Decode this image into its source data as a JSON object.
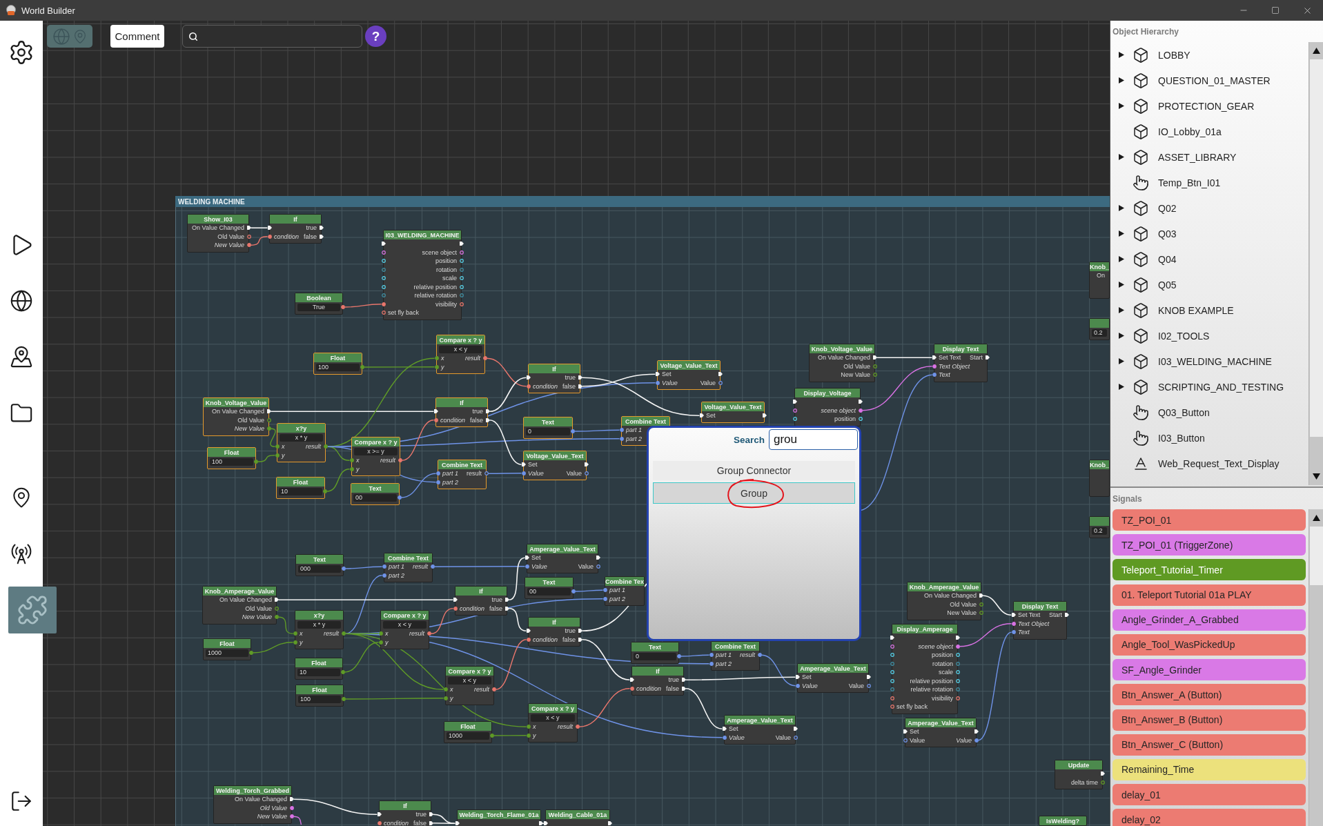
{
  "window": {
    "title": "World Builder"
  },
  "sidebar": {
    "items": [
      {
        "selected": false
      },
      {
        "selected": false
      },
      {
        "selected": false
      },
      {
        "selected": false
      },
      {
        "selected": false
      },
      {
        "selected": false
      },
      {
        "selected": false
      },
      {
        "selected": true
      },
      {
        "selected": false
      }
    ]
  },
  "toolbar": {
    "map_toggle": {
      "disabled": true
    },
    "comment_button": "Comment",
    "help_button": "?"
  },
  "graph": {
    "group": {
      "title": "WELDING MACHINE"
    },
    "nodes": [
      {
        "title": "Show_I03",
        "selected": false,
        "rows": [
          {
            "out": {
              "kind": "exec",
              "label": "On Value Changed"
            }
          },
          {
            "out": {
              "kind": "bool",
              "label": "Old Value",
              "connected": false
            }
          },
          {
            "out": {
              "kind": "bool",
              "label": "New Value",
              "connected": true
            }
          }
        ]
      },
      {
        "title": "If",
        "selected": false,
        "rows": [
          {
            "in": {
              "kind": "exec"
            },
            "out": {
              "kind": "exec",
              "label": "true"
            }
          },
          {
            "in": {
              "kind": "bool",
              "label": "condition",
              "connected": true
            },
            "out": {
              "kind": "exec",
              "label": "false"
            }
          }
        ]
      },
      {
        "title": "Boolean",
        "selected": false,
        "value": "True",
        "value_port": {
          "kind": "bool",
          "connected": true
        }
      },
      {
        "title": "I03_WELDING_MACHINE",
        "selected": false,
        "rows": [
          {
            "in": {
              "kind": "exec"
            },
            "out": {
              "kind": "exec"
            }
          },
          {
            "in": {
              "kind": "object",
              "connected": false
            },
            "out": {
              "kind": "object",
              "label": "scene object",
              "connected": false
            }
          },
          {
            "in": {
              "kind": "vector",
              "connected": false
            },
            "out": {
              "kind": "vector",
              "label": "position",
              "connected": false
            }
          },
          {
            "in": {
              "kind": "rotation",
              "connected": false
            },
            "out": {
              "kind": "rotation",
              "label": "rotation",
              "connected": false
            }
          },
          {
            "in": {
              "kind": "vector",
              "connected": false
            },
            "out": {
              "kind": "vector",
              "label": "scale",
              "connected": false
            }
          },
          {
            "in": {
              "kind": "vector",
              "connected": false
            },
            "out": {
              "kind": "vector",
              "label": "relative position",
              "connected": false
            }
          },
          {
            "in": {
              "kind": "rotation",
              "connected": false
            },
            "out": {
              "kind": "rotation",
              "label": "relative rotation",
              "connected": false
            }
          },
          {
            "in": {
              "kind": "bool",
              "connected": true
            },
            "out": {
              "kind": "bool",
              "label": "visibility",
              "connected": false
            }
          },
          {
            "in": {
              "kind": "bool",
              "label": "set fly back",
              "connected": false
            }
          }
        ]
      },
      {
        "title": "Knob_",
        "selected": false,
        "rows": [
          {
            "out": {
              "label": "On"
            }
          }
        ]
      },
      {
        "selected": false,
        "value": "0.2"
      },
      {
        "title": "Float",
        "selected": true,
        "value": "100",
        "value_port": {
          "kind": "number",
          "connected": true
        }
      },
      {
        "title": "Compare x ? y",
        "selected": true,
        "mode": "x < y",
        "rows": [
          {
            "in": {
              "kind": "number",
              "label": "x",
              "connected": true
            },
            "out": {
              "kind": "bool",
              "label": "result",
              "connected": true
            }
          },
          {
            "in": {
              "kind": "number",
              "label": "y",
              "connected": true
            }
          }
        ]
      },
      {
        "title": "If",
        "selected": true,
        "rows": [
          {
            "in": {
              "kind": "exec"
            },
            "out": {
              "kind": "exec",
              "label": "true"
            }
          },
          {
            "in": {
              "kind": "bool",
              "label": "condition",
              "connected": true
            },
            "out": {
              "kind": "exec",
              "label": "false"
            }
          }
        ]
      },
      {
        "title": "Voltage_Value_Text",
        "selected": true,
        "rows": [
          {
            "in": {
              "kind": "exec",
              "label": "Set"
            },
            "out": {
              "kind": "exec"
            }
          },
          {
            "in": {
              "kind": "text",
              "label": "Value",
              "connected": true
            },
            "out": {
              "kind": "text",
              "label": "Value",
              "connected": false
            }
          }
        ]
      },
      {
        "title": "Knob_Voltage_Value",
        "selected": false,
        "rows": [
          {
            "out": {
              "kind": "exec",
              "label": "On Value Changed"
            }
          },
          {
            "out": {
              "kind": "number",
              "label": "Old Value",
              "connected": false
            }
          },
          {
            "out": {
              "kind": "number",
              "label": "New Value",
              "connected": false
            }
          }
        ]
      },
      {
        "title": "Display Text",
        "selected": false,
        "rows": [
          {
            "in": {
              "kind": "exec",
              "label": "Set Text"
            },
            "out": {
              "kind": "exec",
              "label": "Start"
            }
          },
          {
            "in": {
              "kind": "object",
              "label": "Text Object",
              "connected": true
            }
          },
          {
            "in": {
              "kind": "text",
              "label": "Text",
              "connected": true
            }
          }
        ]
      },
      {
        "title": "Knob_Voltage_Value",
        "selected": true,
        "rows": [
          {
            "out": {
              "kind": "exec",
              "label": "On Value Changed"
            }
          },
          {
            "out": {
              "kind": "number",
              "label": "Old Value",
              "connected": false
            }
          },
          {
            "out": {
              "kind": "number",
              "label": "New Value",
              "connected": true
            }
          }
        ]
      },
      {
        "title": "If",
        "selected": true,
        "rows": [
          {
            "in": {
              "kind": "exec"
            },
            "out": {
              "kind": "exec",
              "label": "true"
            }
          },
          {
            "in": {
              "kind": "bool",
              "label": "condition",
              "connected": true
            },
            "out": {
              "kind": "exec",
              "label": "false"
            }
          }
        ]
      },
      {
        "title": "Voltage_Value_Text",
        "selected": true,
        "rows": [
          {
            "in": {
              "kind": "exec",
              "label": "Set"
            },
            "out": {
              "kind": "exec"
            }
          }
        ]
      },
      {
        "title": "Display_Voltage",
        "selected": false,
        "rows": [
          {
            "in": {
              "kind": "exec"
            },
            "out": {
              "kind": "exec"
            }
          },
          {
            "in": {
              "kind": "object",
              "connected": false
            },
            "out": {
              "kind": "object",
              "label": "scene object",
              "connected": true
            }
          },
          {
            "in": {
              "kind": "vector",
              "connected": false
            },
            "out": {
              "kind": "vector",
              "label": "position",
              "connected": false
            }
          }
        ]
      },
      {
        "title": "Float",
        "selected": true,
        "value": "100",
        "value_port": {
          "kind": "number",
          "connected": true
        }
      },
      {
        "title": "x?y",
        "selected": true,
        "mode": "x * y",
        "rows": [
          {
            "in": {
              "kind": "number",
              "label": "x",
              "connected": true
            },
            "out": {
              "kind": "number",
              "label": "result",
              "connected": true
            }
          },
          {
            "in": {
              "kind": "number",
              "label": "y",
              "connected": true
            }
          }
        ]
      },
      {
        "title": "Text",
        "selected": true,
        "value": "0",
        "value_port": {
          "kind": "text",
          "connected": true
        }
      },
      {
        "title": "Combine Text",
        "selected": true,
        "rows": [
          {
            "in": {
              "kind": "text",
              "label": "part 1",
              "connected": true
            }
          },
          {
            "in": {
              "kind": "text",
              "label": "part 2",
              "connected": true
            }
          }
        ]
      },
      {
        "title": "Compare x ? y",
        "selected": true,
        "mode": "x >= y",
        "rows": [
          {
            "in": {
              "kind": "number",
              "label": "x",
              "connected": true
            },
            "out": {
              "kind": "bool",
              "label": "result",
              "connected": true
            }
          },
          {
            "in": {
              "kind": "number",
              "label": "y",
              "connected": true
            }
          }
        ]
      },
      {
        "title": "Float",
        "selected": true,
        "value": "10",
        "value_port": {
          "kind": "number",
          "connected": true
        }
      },
      {
        "title": "Combine Text",
        "selected": true,
        "rows": [
          {
            "in": {
              "kind": "text",
              "label": "part 1",
              "connected": true
            },
            "out": {
              "kind": "text",
              "label": "result",
              "connected": false
            }
          },
          {
            "in": {
              "kind": "text",
              "label": "part 2",
              "connected": true
            }
          }
        ]
      },
      {
        "title": "Voltage_Value_Text",
        "selected": true,
        "rows": [
          {
            "in": {
              "kind": "exec",
              "label": "Set"
            },
            "out": {
              "kind": "exec"
            }
          },
          {
            "in": {
              "kind": "text",
              "label": "Value",
              "connected": true
            },
            "out": {
              "kind": "text",
              "label": "Value",
              "connected": false
            }
          }
        ]
      },
      {
        "title": "Text",
        "selected": true,
        "value": "00",
        "value_port": {
          "kind": "text",
          "connected": true
        }
      },
      {
        "title": "Knob_",
        "selected": false
      },
      {
        "selected": false,
        "value": "0.2"
      },
      {
        "title": "Text",
        "selected": false,
        "value": "000",
        "value_port": {
          "kind": "text",
          "connected": true
        }
      },
      {
        "title": "Combine Text",
        "selected": false,
        "rows": [
          {
            "in": {
              "kind": "text",
              "label": "part 1",
              "connected": true
            },
            "out": {
              "kind": "text",
              "label": "result",
              "connected": true
            }
          },
          {
            "in": {
              "kind": "text",
              "label": "part 2",
              "connected": true
            }
          }
        ]
      },
      {
        "title": "Amperage_Value_Text",
        "selected": false,
        "rows": [
          {
            "in": {
              "kind": "exec",
              "label": "Set"
            },
            "out": {
              "kind": "exec"
            }
          },
          {
            "in": {
              "kind": "text",
              "label": "Value",
              "connected": true
            },
            "out": {
              "kind": "text",
              "label": "Value",
              "connected": false
            }
          }
        ]
      },
      {
        "title": "Knob_Amperage_Value",
        "selected": false,
        "rows": [
          {
            "out": {
              "kind": "exec",
              "label": "On Value Changed"
            }
          },
          {
            "out": {
              "kind": "number",
              "label": "Old Value",
              "connected": false
            }
          },
          {
            "out": {
              "kind": "number",
              "label": "New Value",
              "connected": true
            }
          }
        ]
      },
      {
        "title": "If",
        "selected": false,
        "rows": [
          {
            "in": {
              "kind": "exec"
            },
            "out": {
              "kind": "exec",
              "label": "true"
            }
          },
          {
            "in": {
              "kind": "bool",
              "label": "condition",
              "connected": true
            },
            "out": {
              "kind": "exec",
              "label": "false"
            }
          }
        ]
      },
      {
        "title": "Text",
        "selected": false,
        "value": "00",
        "value_port": {
          "kind": "text",
          "connected": true
        }
      },
      {
        "title": "Combine Tex",
        "selected": false,
        "rows": [
          {
            "in": {
              "kind": "text",
              "label": "part 1",
              "connected": true
            }
          },
          {
            "in": {
              "kind": "text",
              "label": "part 2",
              "connected": true
            }
          }
        ]
      },
      {
        "title": "Knob_Amperage_Value",
        "selected": false,
        "rows": [
          {
            "out": {
              "kind": "exec",
              "label": "On Value Changed"
            }
          },
          {
            "out": {
              "kind": "number",
              "label": "Old Value",
              "connected": false
            }
          },
          {
            "out": {
              "kind": "number",
              "label": "New Value",
              "connected": false
            }
          }
        ]
      },
      {
        "title": "Float",
        "selected": false,
        "value": "1000",
        "value_port": {
          "kind": "number",
          "connected": true
        }
      },
      {
        "title": "x?y",
        "selected": false,
        "mode": "x * y",
        "rows": [
          {
            "in": {
              "kind": "number",
              "label": "x",
              "connected": true
            },
            "out": {
              "kind": "number",
              "label": "result",
              "connected": true
            }
          },
          {
            "in": {
              "kind": "number",
              "label": "y",
              "connected": true
            }
          }
        ]
      },
      {
        "title": "Compare x ? y",
        "selected": false,
        "mode": "x < y",
        "rows": [
          {
            "in": {
              "kind": "number",
              "label": "x",
              "connected": true
            },
            "out": {
              "kind": "bool",
              "label": "result",
              "connected": true
            }
          },
          {
            "in": {
              "kind": "number",
              "label": "y",
              "connected": true
            }
          }
        ]
      },
      {
        "title": "If",
        "selected": false,
        "rows": [
          {
            "in": {
              "kind": "exec"
            },
            "out": {
              "kind": "exec",
              "label": "true"
            }
          },
          {
            "in": {
              "kind": "bool",
              "label": "condition",
              "connected": true
            },
            "out": {
              "kind": "exec",
              "label": "false"
            }
          }
        ]
      },
      {
        "title": "Display Text",
        "selected": false,
        "rows": [
          {
            "in": {
              "kind": "exec",
              "label": "Set Text"
            },
            "out": {
              "kind": "exec",
              "label": "Start"
            }
          },
          {
            "in": {
              "kind": "object",
              "label": "Text Object",
              "connected": true
            }
          },
          {
            "in": {
              "kind": "text",
              "label": "Text",
              "connected": true
            }
          }
        ]
      },
      {
        "title": "Float",
        "selected": false,
        "value": "10",
        "value_port": {
          "kind": "number",
          "connected": true
        }
      },
      {
        "title": "Text",
        "selected": false,
        "value": "0",
        "value_port": {
          "kind": "text",
          "connected": true
        }
      },
      {
        "title": "Combine Text",
        "selected": false,
        "rows": [
          {
            "in": {
              "kind": "text",
              "label": "part 1",
              "connected": true
            },
            "out": {
              "kind": "text",
              "label": "result",
              "connected": true
            }
          },
          {
            "in": {
              "kind": "text",
              "label": "part 2",
              "connected": true
            }
          }
        ]
      },
      {
        "title": "Float",
        "selected": false,
        "value": "100",
        "value_port": {
          "kind": "number",
          "connected": true
        }
      },
      {
        "title": "Compare x ? y",
        "selected": false,
        "mode": "x < y",
        "rows": [
          {
            "in": {
              "kind": "number",
              "label": "x",
              "connected": true
            },
            "out": {
              "kind": "bool",
              "label": "result",
              "connected": true
            }
          },
          {
            "in": {
              "kind": "number",
              "label": "y",
              "connected": true
            }
          }
        ]
      },
      {
        "title": "If",
        "selected": false,
        "rows": [
          {
            "in": {
              "kind": "exec"
            },
            "out": {
              "kind": "exec",
              "label": "true"
            }
          },
          {
            "in": {
              "kind": "bool",
              "label": "condition",
              "connected": true
            },
            "out": {
              "kind": "exec",
              "label": "false"
            }
          }
        ]
      },
      {
        "title": "Amperage_Value_Text",
        "selected": false,
        "rows": [
          {
            "in": {
              "kind": "exec",
              "label": "Set"
            },
            "out": {
              "kind": "exec"
            }
          },
          {
            "in": {
              "kind": "text",
              "label": "Value",
              "connected": true
            },
            "out": {
              "kind": "text",
              "label": "Value",
              "connected": false
            }
          }
        ]
      },
      {
        "title": "Display_Amperage",
        "selected": false,
        "rows": [
          {
            "in": {
              "kind": "exec"
            },
            "out": {
              "kind": "exec"
            }
          },
          {
            "in": {
              "kind": "object",
              "connected": false
            },
            "out": {
              "kind": "object",
              "label": "scene object",
              "connected": true
            }
          },
          {
            "in": {
              "kind": "vector",
              "connected": false
            },
            "out": {
              "kind": "vector",
              "label": "position",
              "connected": false
            }
          },
          {
            "in": {
              "kind": "rotation",
              "connected": false
            },
            "out": {
              "kind": "rotation",
              "label": "rotation",
              "connected": false
            }
          },
          {
            "in": {
              "kind": "vector",
              "connected": false
            },
            "out": {
              "kind": "vector",
              "label": "scale",
              "connected": false
            }
          },
          {
            "in": {
              "kind": "vector",
              "connected": false
            },
            "out": {
              "kind": "vector",
              "label": "relative position",
              "connected": false
            }
          },
          {
            "in": {
              "kind": "rotation",
              "connected": false
            },
            "out": {
              "kind": "rotation",
              "label": "relative rotation",
              "connected": false
            }
          },
          {
            "in": {
              "kind": "bool",
              "connected": false
            },
            "out": {
              "kind": "bool",
              "label": "visibility",
              "connected": false
            }
          },
          {
            "in": {
              "kind": "bool",
              "label": "set fly back",
              "connected": false
            }
          }
        ]
      },
      {
        "title": "Float",
        "selected": false,
        "value": "1000",
        "value_port": {
          "kind": "number",
          "connected": true
        }
      },
      {
        "title": "Compare x ? y",
        "selected": false,
        "mode": "x < y",
        "rows": [
          {
            "in": {
              "kind": "number",
              "label": "x",
              "connected": true
            },
            "out": {
              "kind": "bool",
              "label": "result",
              "connected": true
            }
          },
          {
            "in": {
              "kind": "number",
              "label": "y",
              "connected": true
            }
          }
        ]
      },
      {
        "title": "Amperage_Value_Text",
        "selected": false,
        "rows": [
          {
            "in": {
              "kind": "exec",
              "label": "Set"
            },
            "out": {
              "kind": "exec"
            }
          },
          {
            "in": {
              "kind": "text",
              "label": "Value",
              "connected": true
            },
            "out": {
              "kind": "text",
              "label": "Value",
              "connected": false
            }
          }
        ]
      },
      {
        "title": "Amperage_Value_Text",
        "selected": false,
        "rows": [
          {
            "in": {
              "kind": "exec",
              "label": "Set"
            },
            "out": {
              "kind": "exec"
            }
          },
          {
            "in": {
              "kind": "text",
              "label": "Value",
              "connected": false
            },
            "out": {
              "kind": "text",
              "label": "Value",
              "connected": true
            }
          }
        ]
      },
      {
        "title": "Update",
        "selected": false,
        "rows": [
          {
            "out": {
              "kind": "exec"
            }
          },
          {
            "out": {
              "kind": "number",
              "label": "delta time",
              "connected": false
            }
          }
        ]
      },
      {
        "title": "Welding_Torch_Grabbed",
        "selected": false,
        "rows": [
          {
            "out": {
              "kind": "exec",
              "label": "On Value Changed"
            }
          },
          {
            "out": {
              "kind": "object",
              "label": "Old Value",
              "connected": true
            }
          },
          {
            "out": {
              "kind": "object",
              "label": "New Value",
              "connected": true
            }
          }
        ]
      },
      {
        "title": "If",
        "selected": false,
        "rows": [
          {
            "in": {
              "kind": "exec"
            },
            "out": {
              "kind": "exec",
              "label": "true"
            }
          },
          {
            "in": {
              "kind": "bool",
              "label": "condition",
              "connected": true
            },
            "out": {
              "kind": "exec",
              "label": "false"
            }
          }
        ]
      },
      {
        "title": "Welding_Torch_Flame_01a",
        "selected": false,
        "rows": [
          {
            "in": {
              "kind": "exec"
            },
            "out": {
              "kind": "exec"
            }
          }
        ]
      },
      {
        "title": "Welding_Cable_01a",
        "selected": false,
        "rows": [
          {
            "in": {
              "kind": "exec"
            },
            "out": {
              "kind": "exec"
            }
          }
        ]
      },
      {
        "title": "IsWelding?",
        "selected": false
      }
    ]
  },
  "search_popup": {
    "label": "Search",
    "query": "grou",
    "results": [
      {
        "label": "Group Connector",
        "selected": false,
        "circled": false
      },
      {
        "label": "Group",
        "selected": true,
        "circled": true
      }
    ]
  },
  "object_hierarchy": {
    "title": "Object Hierarchy",
    "items": [
      {
        "label": "LOBBY",
        "kind": "object",
        "expandable": true
      },
      {
        "label": "QUESTION_01_MASTER",
        "kind": "object",
        "expandable": true
      },
      {
        "label": "PROTECTION_GEAR",
        "kind": "object",
        "expandable": true
      },
      {
        "label": "IO_Lobby_01a",
        "kind": "object",
        "expandable": false
      },
      {
        "label": "ASSET_LIBRARY",
        "kind": "object",
        "expandable": true
      },
      {
        "label": "Temp_Btn_I01",
        "kind": "button",
        "expandable": false
      },
      {
        "label": "Q02",
        "kind": "object",
        "expandable": true
      },
      {
        "label": "Q03",
        "kind": "object",
        "expandable": true
      },
      {
        "label": "Q04",
        "kind": "object",
        "expandable": true
      },
      {
        "label": "Q05",
        "kind": "object",
        "expandable": true
      },
      {
        "label": "KNOB EXAMPLE",
        "kind": "object",
        "expandable": true
      },
      {
        "label": "I02_TOOLS",
        "kind": "object",
        "expandable": true
      },
      {
        "label": "I03_WELDING_MACHINE",
        "kind": "object",
        "expandable": true
      },
      {
        "label": "SCRIPTING_AND_TESTING",
        "kind": "object",
        "expandable": true
      },
      {
        "label": "Q03_Button",
        "kind": "button",
        "expandable": false
      },
      {
        "label": "I03_Button",
        "kind": "button",
        "expandable": false
      },
      {
        "label": "Web_Request_Text_Display",
        "kind": "text",
        "expandable": false
      }
    ]
  },
  "signals": {
    "title": "Signals",
    "items": [
      {
        "label": "TZ_POI_01",
        "color": "#ec7b72"
      },
      {
        "label": "TZ_POI_01 (TriggerZone)",
        "color": "#d979e6"
      },
      {
        "label": "Teleport_Tutorial_Timer",
        "color": "#5f9a23"
      },
      {
        "label": "01. Teleport Tutorial 01a PLAY",
        "color": "#ec7b72"
      },
      {
        "label": "Angle_Grinder_A_Grabbed",
        "color": "#d979e6"
      },
      {
        "label": "Angle_Tool_WasPickedUp",
        "color": "#ec7b72"
      },
      {
        "label": "SF_Angle_Grinder",
        "color": "#d979e6"
      },
      {
        "label": "Btn_Answer_A (Button)",
        "color": "#ec7b72"
      },
      {
        "label": "Btn_Answer_B (Button)",
        "color": "#ec7b72"
      },
      {
        "label": "Btn_Answer_C (Button)",
        "color": "#ec7b72"
      },
      {
        "label": "Remaining_Time",
        "color": "#ece17c"
      },
      {
        "label": "delay_01",
        "color": "#ec7b72"
      },
      {
        "label": "delay_02",
        "color": "#ec7b72"
      }
    ]
  }
}
